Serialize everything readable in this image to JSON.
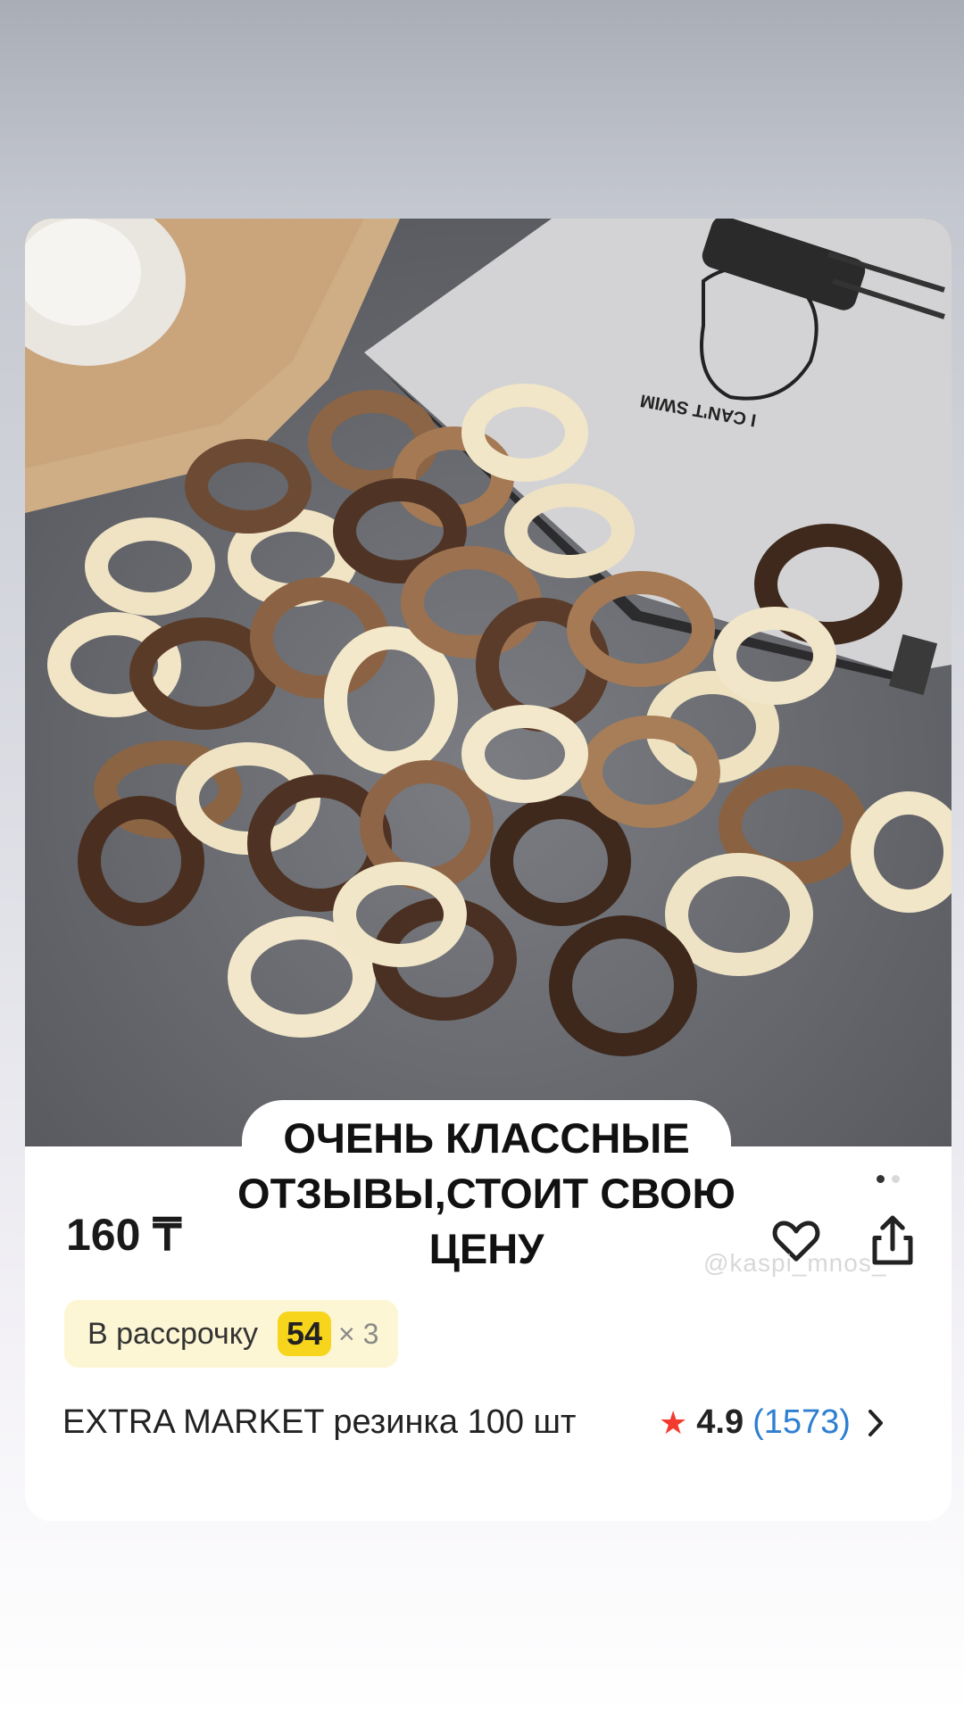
{
  "product": {
    "price": "160 ₸",
    "installment_label": "В рассрочку",
    "installment_amount": "54",
    "installment_multiplier": "× 3",
    "title": "EXTRA MARKET резинка 100 шт",
    "rating": "4.9",
    "reviews_count": "(1573)",
    "gallery_pages": 2,
    "gallery_current": 1,
    "bag_text": "I CAN'T SWIM"
  },
  "overlay": {
    "caption": "ОЧЕНЬ КЛАССНЫЕ ОТЗЫВЫ,СТОИТ СВОЮ ЦЕНУ"
  },
  "watermark": {
    "text": "@kaspi_mnos_"
  },
  "icons": {
    "favorite": "heart-icon",
    "share": "share-icon",
    "rating": "star-icon",
    "more": "chevron-right-icon"
  },
  "colors": {
    "accent_yellow": "#f7d51c",
    "installment_bg": "#fdf6d4",
    "rating_star": "#f23b2e",
    "link_blue": "#2f7fd1"
  }
}
